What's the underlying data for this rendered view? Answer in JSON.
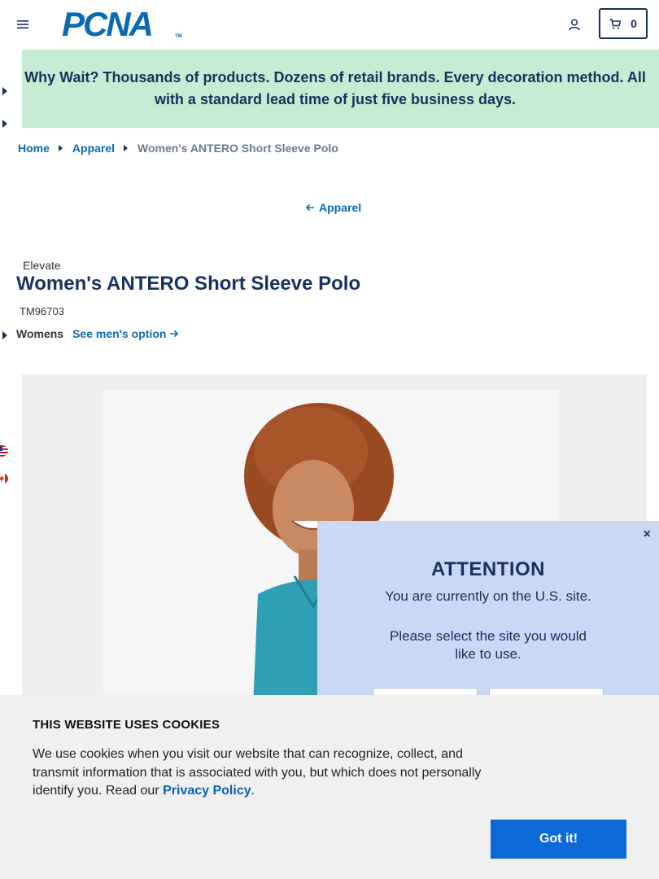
{
  "header": {
    "logo_text": "PCNA",
    "logo_tm": "TM",
    "cart_count": "0",
    "icons": [
      "hamburger-menu-icon",
      "account-icon",
      "cart-icon"
    ]
  },
  "promo": {
    "text": "Why Wait? Thousands of products. Dozens of retail brands. Every decoration method. All with a standard lead time of just five business days."
  },
  "breadcrumb": {
    "items": [
      "Home",
      "Apparel"
    ],
    "current": "Women's ANTERO Short Sleeve Polo"
  },
  "back_link": {
    "label": "Apparel"
  },
  "product": {
    "brand": "Elevate",
    "title": "Women's ANTERO Short Sleeve Polo",
    "sku": "TM96703",
    "gender": "Womens",
    "mens_option_label": "See men's option",
    "image_alt": "Woman wearing teal polo"
  },
  "site_modal": {
    "close": "×",
    "title": "ATTENTION",
    "line1": "You are currently on the U.S. site.",
    "line2": "Please select the site you would like to use."
  },
  "cookie": {
    "title": "THIS WEBSITE USES COOKIES",
    "text": "We use cookies when you visit our website that can recognize, collect, and transmit information that is associated with you, but which does not personally identify you. Read our ",
    "link": "Privacy Policy",
    "text_end": ".",
    "button": "Got it!"
  },
  "colors": {
    "brand_blue": "#0b6ab3",
    "navy": "#17325f",
    "promo_bg": "#c6ecd3",
    "modal_bg": "#c9d8f3",
    "cookie_button": "#0b6ad8"
  }
}
